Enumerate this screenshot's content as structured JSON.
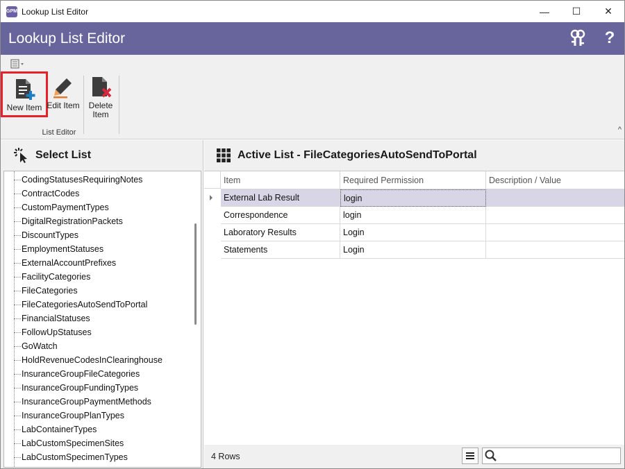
{
  "window": {
    "title": "Lookup List Editor",
    "app_icon_text": "GPM",
    "controls": {
      "minimize": "—",
      "maximize": "☐",
      "close": "✕"
    }
  },
  "header": {
    "title": "Lookup List Editor",
    "icons": [
      "keys-icon",
      "help-icon"
    ],
    "help_glyph": "?",
    "color": "#67659b"
  },
  "ribbon": {
    "buttons": [
      {
        "label": "New Item",
        "highlighted": true
      },
      {
        "label": "Edit Item"
      },
      {
        "label": "Delete Item",
        "label_lines": [
          "Delete",
          "Item"
        ]
      }
    ],
    "group_label": "List Editor",
    "collapse_glyph": "^"
  },
  "select_list": {
    "title": "Select List",
    "items": [
      "CodingStatusesRequiringNotes",
      "ContractCodes",
      "CustomPaymentTypes",
      "DigitalRegistrationPackets",
      "DiscountTypes",
      "EmploymentStatuses",
      "ExternalAccountPrefixes",
      "FacilityCategories",
      "FileCategories",
      "FileCategoriesAutoSendToPortal",
      "FinancialStatuses",
      "FollowUpStatuses",
      "GoWatch",
      "HoldRevenueCodesInClearinghouse",
      "InsuranceGroupFileCategories",
      "InsuranceGroupFundingTypes",
      "InsuranceGroupPaymentMethods",
      "InsuranceGroupPlanTypes",
      "LabContainerTypes",
      "LabCustomSpecimenSites",
      "LabCustomSpecimenTypes"
    ]
  },
  "active_list": {
    "title": "Active List - FileCategoriesAutoSendToPortal",
    "columns": [
      "Item",
      "Required Permission",
      "Description / Value"
    ],
    "rows": [
      [
        "External Lab Result",
        "login",
        ""
      ],
      [
        "Correspondence",
        "login",
        ""
      ],
      [
        "Laboratory Results",
        "Login",
        ""
      ],
      [
        "Statements",
        "Login",
        ""
      ]
    ],
    "selected_row": 0,
    "row_count": "4 Rows",
    "search": {
      "value": "",
      "placeholder": ""
    }
  },
  "colors": {
    "highlight_border": "#e8202a",
    "selected_row": "#d8d6e6"
  }
}
